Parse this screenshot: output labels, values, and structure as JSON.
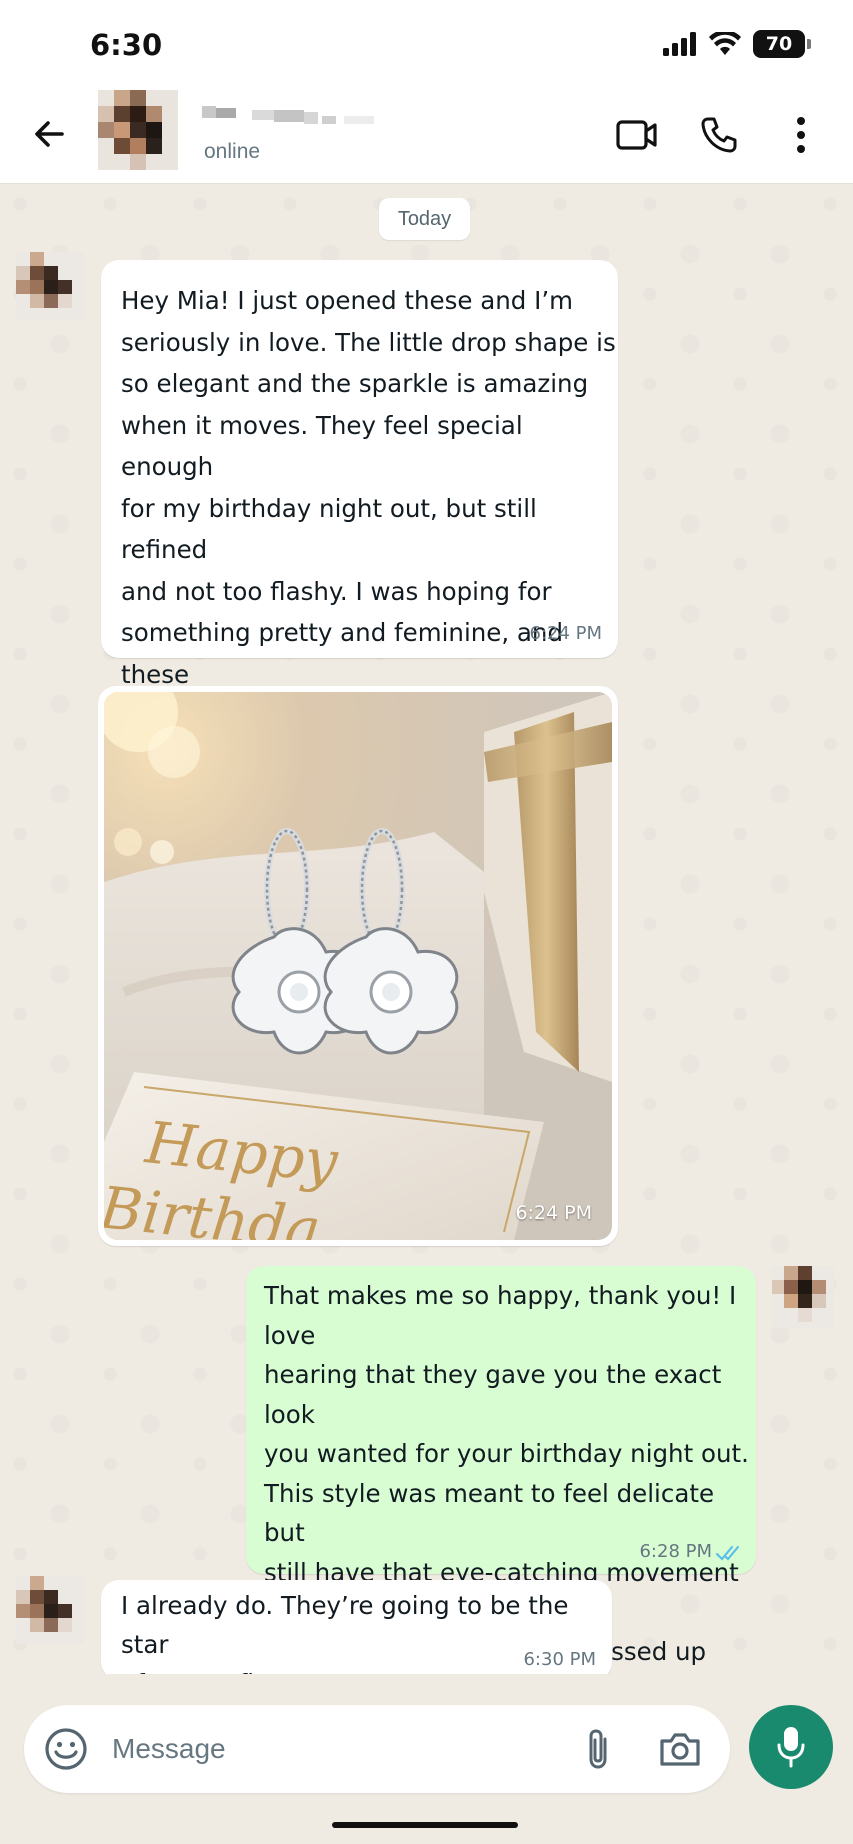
{
  "status_bar": {
    "time": "6:30",
    "battery": "70"
  },
  "header": {
    "contact_status": "online"
  },
  "chat": {
    "date_chip": "Today",
    "messages": [
      {
        "direction": "incoming",
        "text": "Hey Mia! I just opened these and I’m\nseriously in love. The little drop shape is\nso elegant and the sparkle is amazing\nwhen it moves. They feel special enough\nfor my birthday night out, but still refined\nand not too flashy. I was hoping for\nsomething pretty and feminine, and these\nare exactly that. They look so much more\nexpensive than they are.",
        "time": "6:24 PM"
      },
      {
        "direction": "incoming",
        "type": "image",
        "image_text": "Happy Birthda",
        "time": "6:24 PM"
      },
      {
        "direction": "outgoing",
        "text": "That makes me so happy, thank you! I love\nhearing that they gave you the exact look\nyou wanted for your birthday night out.\nThis style was meant to feel delicate but\nstill have that eye-catching movement and\nshine. I hope you feel so dressed up and\nbeautiful wearing them.",
        "time": "6:28 PM",
        "read": true
      },
      {
        "direction": "incoming",
        "text": "I already do. They’re going to be the star\nof my outfit.",
        "time": "6:30 PM"
      }
    ]
  },
  "composer": {
    "placeholder": "Message"
  },
  "icons": {
    "back": "arrow-left-icon",
    "video": "video-call-icon",
    "phone": "phone-icon",
    "menu": "more-vert-icon",
    "emoji": "emoji-icon",
    "attach": "paperclip-icon",
    "camera": "camera-icon",
    "mic": "mic-icon",
    "read_receipt": "double-check-icon"
  },
  "colors": {
    "chat_bg": "#efeae2",
    "incoming_bubble": "#ffffff",
    "outgoing_bubble": "#d9fdd3",
    "accent": "#1a8a6e",
    "read_tick": "#53bdeb"
  }
}
